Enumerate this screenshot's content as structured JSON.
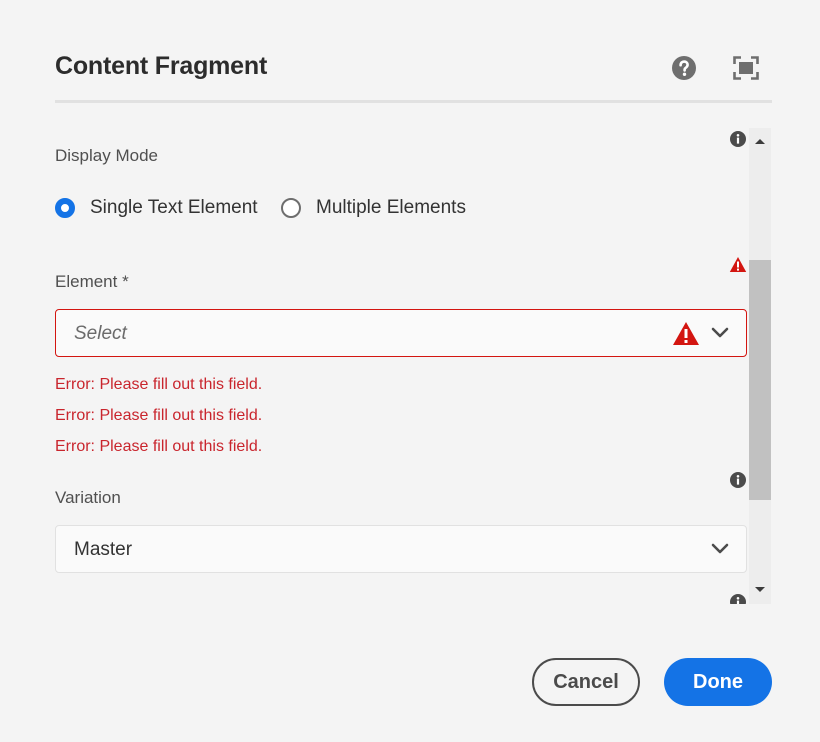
{
  "dialog": {
    "title": "Content Fragment",
    "help_icon": "help-circle-icon",
    "fullscreen_icon": "fullscreen-icon"
  },
  "display_mode": {
    "label": "Display Mode",
    "options": [
      {
        "label": "Single Text Element",
        "checked": true
      },
      {
        "label": "Multiple Elements",
        "checked": false
      }
    ]
  },
  "element": {
    "label": "Element *",
    "placeholder": "Select",
    "errors": [
      "Error: Please fill out this field.",
      "Error: Please fill out this field.",
      "Error: Please fill out this field."
    ]
  },
  "variation": {
    "label": "Variation",
    "value": "Master"
  },
  "footer": {
    "cancel_label": "Cancel",
    "done_label": "Done"
  },
  "colors": {
    "accent": "#1473e6",
    "error": "#c9252d",
    "alert": "#d31510"
  }
}
